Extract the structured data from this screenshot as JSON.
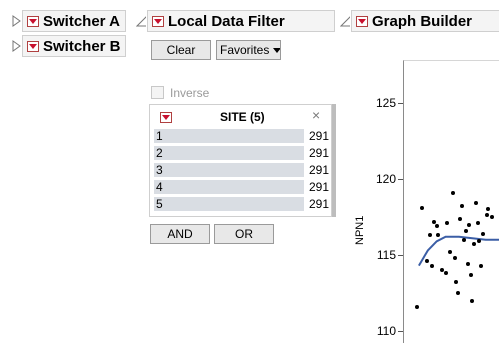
{
  "panels": {
    "switcher_a": "Switcher A",
    "switcher_b": "Switcher B",
    "local_data_filter": "Local Data Filter",
    "graph_builder": "Graph Builder"
  },
  "filter": {
    "clear_label": "Clear",
    "favorites_label": "Favorites",
    "inverse_label": "Inverse",
    "title": "SITE (5)",
    "close": "×",
    "items": [
      {
        "label": "1",
        "count": "291"
      },
      {
        "label": "2",
        "count": "291"
      },
      {
        "label": "3",
        "count": "291"
      },
      {
        "label": "4",
        "count": "291"
      },
      {
        "label": "5",
        "count": "291"
      }
    ],
    "and_label": "AND",
    "or_label": "OR"
  },
  "chart_data": {
    "type": "scatter",
    "ylabel": "NPN1",
    "ylim": [
      110,
      126
    ],
    "yticks": [
      "125",
      "120",
      "115",
      "110"
    ],
    "points": [
      {
        "x": 0.08,
        "y": 111.6
      },
      {
        "x": 0.13,
        "y": 118.1
      },
      {
        "x": 0.19,
        "y": 114.6
      },
      {
        "x": 0.23,
        "y": 116.3
      },
      {
        "x": 0.25,
        "y": 114.3
      },
      {
        "x": 0.27,
        "y": 117.2
      },
      {
        "x": 0.3,
        "y": 116.9
      },
      {
        "x": 0.32,
        "y": 116.3
      },
      {
        "x": 0.36,
        "y": 114.0
      },
      {
        "x": 0.4,
        "y": 113.8
      },
      {
        "x": 0.42,
        "y": 117.1
      },
      {
        "x": 0.45,
        "y": 115.2
      },
      {
        "x": 0.48,
        "y": 119.1
      },
      {
        "x": 0.5,
        "y": 114.8
      },
      {
        "x": 0.52,
        "y": 113.2
      },
      {
        "x": 0.54,
        "y": 112.5
      },
      {
        "x": 0.56,
        "y": 117.4
      },
      {
        "x": 0.58,
        "y": 118.2
      },
      {
        "x": 0.61,
        "y": 116.0
      },
      {
        "x": 0.63,
        "y": 116.6
      },
      {
        "x": 0.65,
        "y": 114.4
      },
      {
        "x": 0.66,
        "y": 117.0
      },
      {
        "x": 0.68,
        "y": 113.7
      },
      {
        "x": 0.7,
        "y": 112.0
      },
      {
        "x": 0.72,
        "y": 115.7
      },
      {
        "x": 0.74,
        "y": 118.4
      },
      {
        "x": 0.76,
        "y": 117.1
      },
      {
        "x": 0.78,
        "y": 115.9
      },
      {
        "x": 0.8,
        "y": 114.3
      },
      {
        "x": 0.82,
        "y": 116.4
      },
      {
        "x": 0.86,
        "y": 117.6
      },
      {
        "x": 0.88,
        "y": 118.0
      },
      {
        "x": 0.92,
        "y": 117.5
      }
    ],
    "fit_line": [
      {
        "x": 0.1,
        "y": 114.3
      },
      {
        "x": 0.2,
        "y": 115.3
      },
      {
        "x": 0.3,
        "y": 115.9
      },
      {
        "x": 0.4,
        "y": 116.2
      },
      {
        "x": 0.55,
        "y": 116.2
      },
      {
        "x": 0.7,
        "y": 116.1
      },
      {
        "x": 0.85,
        "y": 116.0
      },
      {
        "x": 1.0,
        "y": 116.0
      }
    ]
  },
  "colors": {
    "menu_triangle": "#c8102e",
    "fit_line": "#3b5ea6",
    "filter_row": "#d9dde3"
  }
}
